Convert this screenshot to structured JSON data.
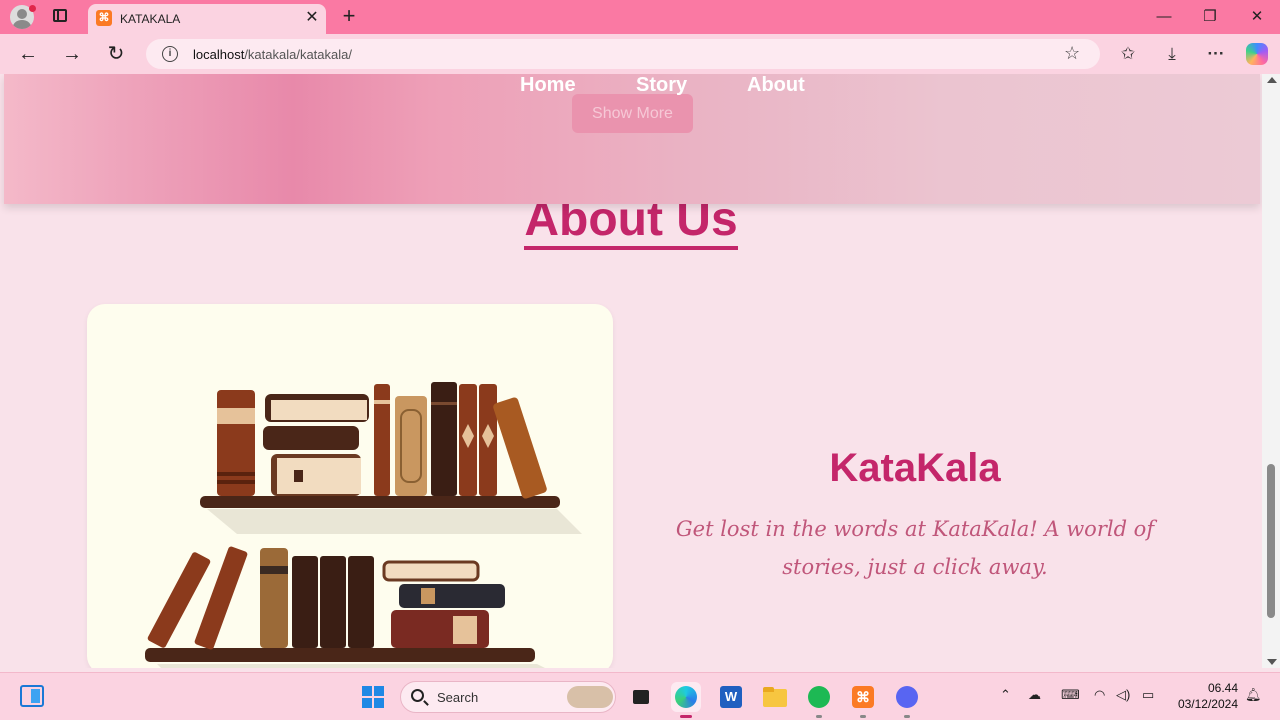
{
  "browser": {
    "tab_title": "KATAKALA",
    "url_host": "localhost",
    "url_path": "/katakala/katakala/"
  },
  "header": {
    "show_more_label": "Show More",
    "nav": [
      {
        "label": "Home"
      },
      {
        "label": "Story"
      },
      {
        "label": "About"
      }
    ]
  },
  "about": {
    "title": "About Us",
    "brand_name": "KataKala",
    "tagline": "Get lost in the words at KataKala! A world of stories, just a click away."
  },
  "taskbar": {
    "search_label": "Search",
    "time": "06.44",
    "date": "03/12/2024"
  },
  "colors": {
    "accent": "#c4266a",
    "tab_bar": "#fa79a3",
    "page_bg": "#f9e2ea",
    "card_bg": "#fefdee"
  },
  "icons": {
    "back": "arrow-left-icon",
    "forward": "arrow-right-icon",
    "reload": "reload-icon",
    "favorite": "star-icon",
    "download": "download-icon",
    "more": "more-icon"
  },
  "scroll_position_fraction": 0.66
}
